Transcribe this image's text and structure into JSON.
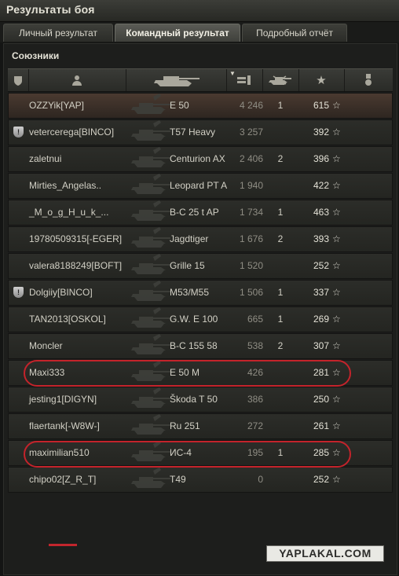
{
  "window": {
    "title": "Результаты боя"
  },
  "tabs": [
    {
      "label": "Личный результат",
      "active": false
    },
    {
      "label": "Командный результат",
      "active": true
    },
    {
      "label": "Подробный отчёт",
      "active": false
    }
  ],
  "section": {
    "title": "Союзники"
  },
  "header_icons": [
    "platoon-icon",
    "player-icon",
    "tank-icon",
    "damage-icon",
    "kills-icon",
    "score-star-icon",
    "medal-icon"
  ],
  "rows": [
    {
      "platoon": "",
      "player": "OZZYik[YAP]",
      "vehicle": "E 50",
      "exp": "4 246",
      "kills": "1",
      "score": "615",
      "star": "☆"
    },
    {
      "platoon": "!",
      "player": "vetercerega[BINCO]",
      "vehicle": "T57 Heavy",
      "exp": "3 257",
      "kills": "",
      "score": "392",
      "star": "☆"
    },
    {
      "platoon": "",
      "player": "zaletnui",
      "vehicle": "Centurion AX",
      "exp": "2 406",
      "kills": "2",
      "score": "396",
      "star": "☆"
    },
    {
      "platoon": "",
      "player": "Mirties_Angelas..",
      "vehicle": "Leopard PT A",
      "exp": "1 940",
      "kills": "",
      "score": "422",
      "star": "☆"
    },
    {
      "platoon": "",
      "player": "_M_o_g_H_u_k_...",
      "vehicle": "B-C 25 t AP",
      "exp": "1 734",
      "kills": "1",
      "score": "463",
      "star": "☆"
    },
    {
      "platoon": "",
      "player": "19780509315[-EGER]",
      "vehicle": "Jagdtiger",
      "exp": "1 676",
      "kills": "2",
      "score": "393",
      "star": "☆"
    },
    {
      "platoon": "",
      "player": "valera8188249[BOFT]",
      "vehicle": "Grille 15",
      "exp": "1 520",
      "kills": "",
      "score": "252",
      "star": "☆"
    },
    {
      "platoon": "!",
      "player": "Dolgiiy[BINCO]",
      "vehicle": "M53/M55",
      "exp": "1 506",
      "kills": "1",
      "score": "337",
      "star": "☆"
    },
    {
      "platoon": "",
      "player": "TAN2013[OSKOL]",
      "vehicle": "G.W. E 100",
      "exp": "665",
      "kills": "1",
      "score": "269",
      "star": "☆"
    },
    {
      "platoon": "",
      "player": "Moncler",
      "vehicle": "B-C 155 58",
      "exp": "538",
      "kills": "2",
      "score": "307",
      "star": "☆"
    },
    {
      "platoon": "",
      "player": "Maxi333",
      "vehicle": "E 50 M",
      "exp": "426",
      "kills": "",
      "score": "281",
      "star": "☆"
    },
    {
      "platoon": "",
      "player": "jesting1[DIGYN]",
      "vehicle": "Škoda T 50",
      "exp": "386",
      "kills": "",
      "score": "250",
      "star": "☆"
    },
    {
      "platoon": "",
      "player": "flaertank[-W8W-]",
      "vehicle": "Ru 251",
      "exp": "272",
      "kills": "",
      "score": "261",
      "star": "☆"
    },
    {
      "platoon": "",
      "player": "maximilian510",
      "vehicle": "ИС-4",
      "exp": "195",
      "kills": "1",
      "score": "285",
      "star": "☆"
    },
    {
      "platoon": "",
      "player": "chipo02[Z_R_T]",
      "vehicle": "T49",
      "exp": "0",
      "kills": "",
      "score": "252",
      "star": "☆"
    }
  ],
  "highlighted_rows": [
    "Maxi333",
    "maximilian510"
  ],
  "watermark": "YAPLAKAL.COM",
  "colors": {
    "highlight_oval": "#c4232b",
    "first_row": "#4a3a30"
  }
}
